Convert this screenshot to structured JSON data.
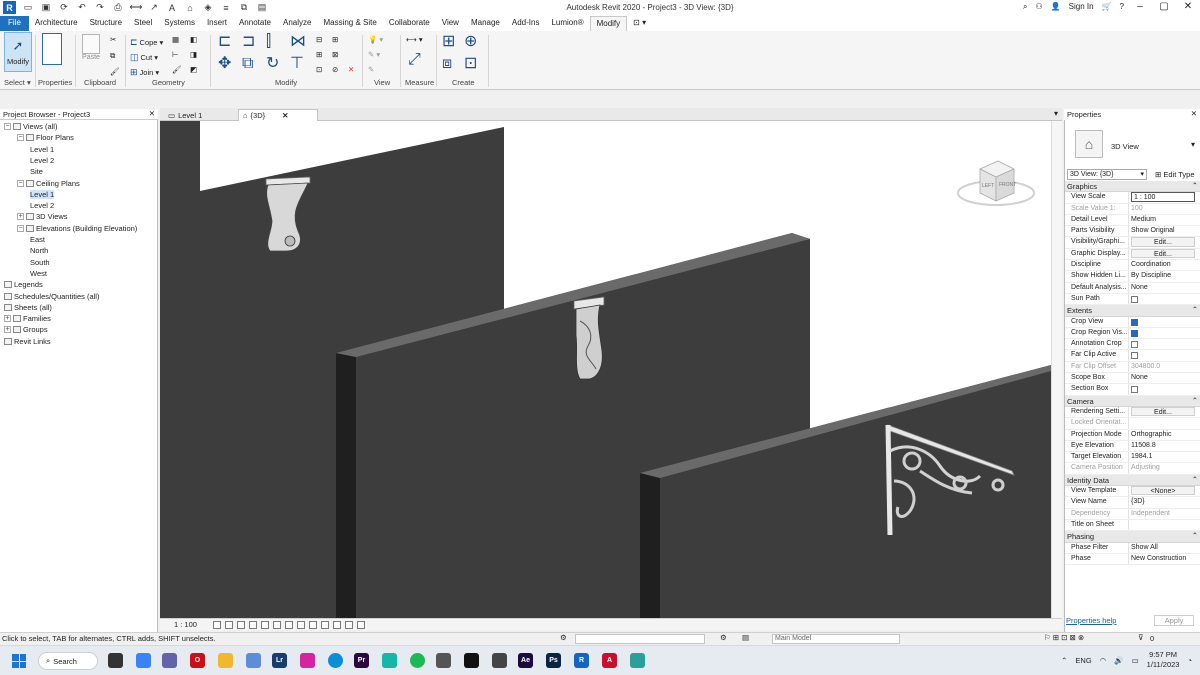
{
  "app": {
    "title": "Autodesk Revit 2020 - Project3 - 3D View: {3D}",
    "sign_in": "Sign In"
  },
  "ribbon_tabs": [
    "File",
    "Architecture",
    "Structure",
    "Steel",
    "Systems",
    "Insert",
    "Annotate",
    "Analyze",
    "Massing & Site",
    "Collaborate",
    "View",
    "Manage",
    "Add-Ins",
    "Lumion®",
    "Modify"
  ],
  "active_tab": "Modify",
  "ribbon": {
    "modify_label": "Modify",
    "paste_label": "Paste",
    "cope_label": "Cope",
    "cut_label": "Cut",
    "join_label": "Join",
    "panels": {
      "select": "Select",
      "properties": "Properties",
      "clipboard": "Clipboard",
      "geometry": "Geometry",
      "modify": "Modify",
      "view": "View",
      "measure": "Measure",
      "create": "Create"
    }
  },
  "project_browser": {
    "title": "Project Browser - Project3",
    "nodes": [
      {
        "label": "Views (all)",
        "level": 0,
        "toggle": "−"
      },
      {
        "label": "Floor Plans",
        "level": 1,
        "toggle": "−"
      },
      {
        "label": "Level 1",
        "level": 2
      },
      {
        "label": "Level 2",
        "level": 2
      },
      {
        "label": "Site",
        "level": 2
      },
      {
        "label": "Ceiling Plans",
        "level": 1,
        "toggle": "−"
      },
      {
        "label": "Level 1",
        "level": 2,
        "selected": true
      },
      {
        "label": "Level 2",
        "level": 2
      },
      {
        "label": "3D Views",
        "level": 1,
        "toggle": "+"
      },
      {
        "label": "Elevations (Building Elevation)",
        "level": 1,
        "toggle": "−"
      },
      {
        "label": "East",
        "level": 2
      },
      {
        "label": "North",
        "level": 2
      },
      {
        "label": "South",
        "level": 2
      },
      {
        "label": "West",
        "level": 2
      },
      {
        "label": "Legends",
        "level": 0
      },
      {
        "label": "Schedules/Quantities (all)",
        "level": 0
      },
      {
        "label": "Sheets (all)",
        "level": 0
      },
      {
        "label": "Families",
        "level": 0,
        "toggle": "+"
      },
      {
        "label": "Groups",
        "level": 0,
        "toggle": "+"
      },
      {
        "label": "Revit Links",
        "level": 0
      }
    ]
  },
  "view_tabs": [
    {
      "label": "Level 1",
      "active": false
    },
    {
      "label": "{3D}",
      "active": true
    }
  ],
  "view_cube": {
    "left": "LEFT",
    "front": "FRONT"
  },
  "view_control_bar": {
    "scale": "1 : 100"
  },
  "properties": {
    "title": "Properties",
    "type_name": "3D View",
    "filter_value": "3D View: {3D}",
    "edit_type": "Edit Type",
    "sections": [
      {
        "name": "Graphics",
        "rows": [
          {
            "key": "View Scale",
            "value": "1 : 100",
            "style": "boxed"
          },
          {
            "key": "Scale Value    1:",
            "value": "100",
            "dim": true
          },
          {
            "key": "Detail Level",
            "value": "Medium"
          },
          {
            "key": "Parts Visibility",
            "value": "Show Original"
          },
          {
            "key": "Visibility/Graphi...",
            "value": "Edit...",
            "style": "btn"
          },
          {
            "key": "Graphic Display...",
            "value": "Edit...",
            "style": "btn"
          },
          {
            "key": "Discipline",
            "value": "Coordination"
          },
          {
            "key": "Show Hidden Li...",
            "value": "By Discipline"
          },
          {
            "key": "Default Analysis...",
            "value": "None"
          },
          {
            "key": "Sun Path",
            "checkbox": false
          }
        ]
      },
      {
        "name": "Extents",
        "rows": [
          {
            "key": "Crop View",
            "checkbox": true
          },
          {
            "key": "Crop Region Vis...",
            "checkbox": true
          },
          {
            "key": "Annotation Crop",
            "checkbox": false
          },
          {
            "key": "Far Clip Active",
            "checkbox": false
          },
          {
            "key": "Far Clip Offset",
            "value": "304800.0",
            "dim": true
          },
          {
            "key": "Scope Box",
            "value": "None"
          },
          {
            "key": "Section Box",
            "checkbox": false
          }
        ]
      },
      {
        "name": "Camera",
        "rows": [
          {
            "key": "Rendering Setti...",
            "value": "Edit...",
            "style": "btn"
          },
          {
            "key": "Locked Orientat...",
            "value": "",
            "dim": true
          },
          {
            "key": "Projection Mode",
            "value": "Orthographic"
          },
          {
            "key": "Eye Elevation",
            "value": "11508.8"
          },
          {
            "key": "Target Elevation",
            "value": "1984.1"
          },
          {
            "key": "Camera Position",
            "value": "Adjusting",
            "dim": true
          }
        ]
      },
      {
        "name": "Identity Data",
        "rows": [
          {
            "key": "View Template",
            "value": "<None>",
            "style": "btn"
          },
          {
            "key": "View Name",
            "value": "{3D}"
          },
          {
            "key": "Dependency",
            "value": "Independent",
            "dim": true
          },
          {
            "key": "Title on Sheet",
            "value": ""
          }
        ]
      },
      {
        "name": "Phasing",
        "rows": [
          {
            "key": "Phase Filter",
            "value": "Show All"
          },
          {
            "key": "Phase",
            "value": "New Construction"
          }
        ]
      }
    ],
    "help": "Properties help",
    "apply": "Apply"
  },
  "status_bar": {
    "message": "Click to select, TAB for alternates, CTRL adds, SHIFT unselects.",
    "model": "Main Model",
    "filter_count": "0"
  },
  "taskbar": {
    "search": "Search",
    "language": "ENG",
    "time": "9:57 PM",
    "date": "1/11/2023",
    "apps": [
      {
        "name": "file-explorer",
        "label": "",
        "color": "#f2b82d"
      },
      {
        "name": "photoshop",
        "label": "Ps",
        "color": "#0a2540"
      },
      {
        "name": "premiere",
        "label": "Pr",
        "color": "#2a0a3e"
      },
      {
        "name": "after-effects",
        "label": "Ae",
        "color": "#1a0a3e"
      },
      {
        "name": "revit",
        "label": "R",
        "color": "#1565c0"
      },
      {
        "name": "autocad",
        "label": "A",
        "color": "#c8102e"
      }
    ]
  }
}
